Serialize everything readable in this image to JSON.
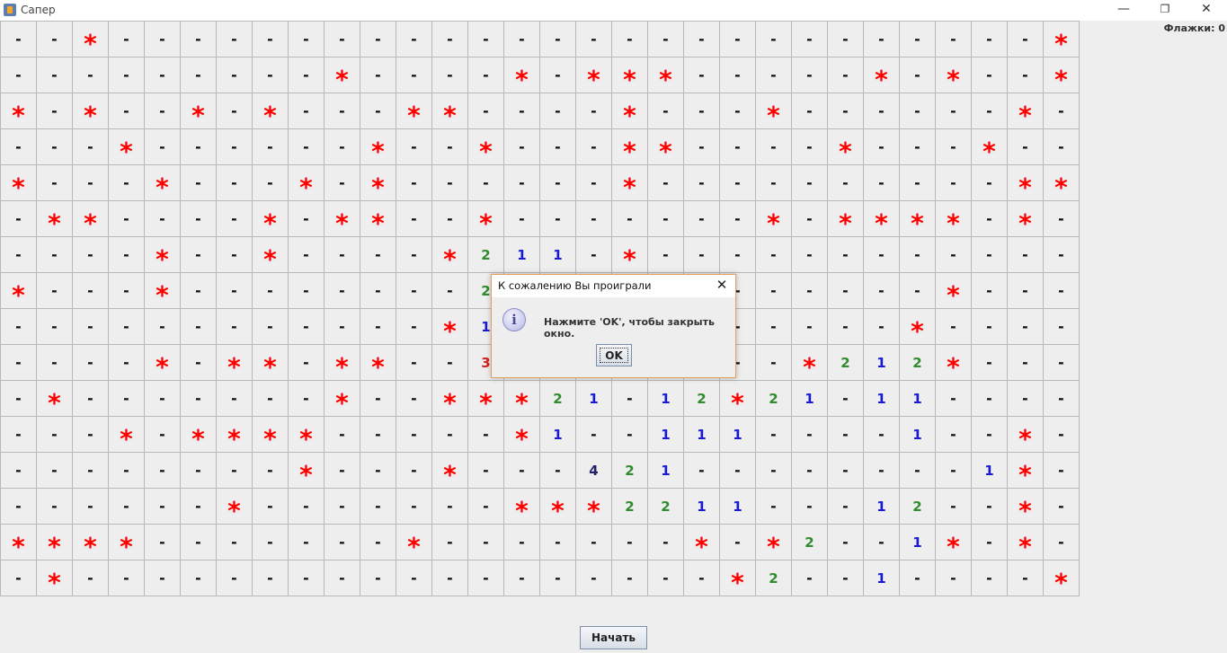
{
  "window": {
    "title": "Сапер",
    "minimize": "—",
    "maximize": "❐",
    "close": "✕"
  },
  "status": {
    "flags_label": "Флажки: 0"
  },
  "board": {
    "rows": [
      "--*--------------------------*",
      "---------*----*-***-----*-*--*",
      "*-*--*-*---**----*---*------*-",
      "---*------*--*---**----*---*--",
      "*---*---*-*------*----------**",
      "-**----*-**--*-------*-****-*-",
      "----*--*----*211-*------------",
      "*---*--------2------------*---",
      "------------*1-----------*----",
      "----*-**-**--3--------*212*---",
      "-*-------*--***21-12*21-11----",
      "---*-****-----*1--111----1--*-",
      "--------*---*---421--------1*-",
      "------*-------***2211---12--*-",
      "****-------*-------*-*2--1*-*-",
      "-*------------------*2--1----*"
    ],
    "hidden_glyph": "-",
    "mine_glyph": "*",
    "number_colors": {
      "1": "#1a1ad6",
      "2": "#2e8b2e",
      "3": "#d42020",
      "4": "#22226b"
    }
  },
  "controls": {
    "start_label": "Начать"
  },
  "dialog": {
    "title": "К сожалению Вы проиграли",
    "close": "✕",
    "icon": "i",
    "message": "Нажмите 'OK', чтобы закрыть окно.",
    "ok_label": "OK"
  }
}
